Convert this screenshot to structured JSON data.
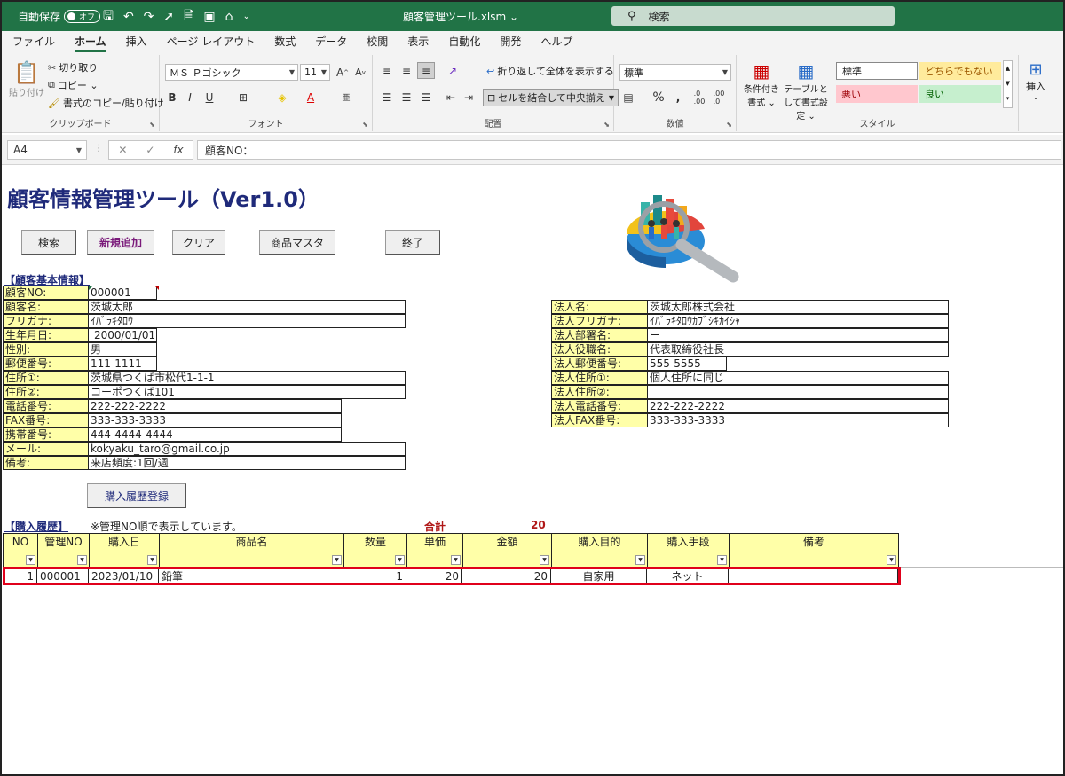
{
  "titlebar": {
    "autosave_label": "自動保存",
    "autosave_state": "オフ",
    "filename": "顧客管理ツール.xlsm ⌄",
    "search_placeholder": "検索"
  },
  "menu": [
    "ファイル",
    "ホーム",
    "挿入",
    "ページ レイアウト",
    "数式",
    "データ",
    "校閲",
    "表示",
    "自動化",
    "開発",
    "ヘルプ"
  ],
  "ribbon": {
    "clipboard": {
      "paste": "貼り付け",
      "cut": "切り取り",
      "copy": "コピー ⌄",
      "format_painter": "書式のコピー/貼り付け",
      "label": "クリップボード"
    },
    "font": {
      "name": "ＭＳ Ｐゴシック",
      "size": "11",
      "label": "フォント"
    },
    "alignment": {
      "wrap": "折り返して全体を表示する",
      "merge": "セルを結合して中央揃え",
      "label": "配置"
    },
    "number": {
      "format": "標準",
      "label": "数値"
    },
    "styles": {
      "cond": "条件付き書式 ⌄",
      "table": "テーブルとして書式設定 ⌄",
      "normal": "標準",
      "neutral": "どちらでもない",
      "bad": "悪い",
      "good": "良い",
      "label": "スタイル"
    },
    "cells": {
      "insert": "挿入"
    }
  },
  "formula_bar": {
    "cell": "A4",
    "content": "顧客NO："
  },
  "sheet": {
    "title": "顧客情報管理ツール（Ver1.0）",
    "buttons": {
      "search": "検索",
      "add": "新規追加",
      "clear": "クリア",
      "master": "商品マスタ",
      "exit": "終了",
      "register": "購入履歴登録"
    },
    "basic_title": "【顧客基本情報】",
    "basic_fields": [
      {
        "label": "顧客NO:",
        "value": "000001"
      },
      {
        "label": "顧客名:",
        "value": "茨城太郎"
      },
      {
        "label": "フリガナ:",
        "value": "ｲﾊﾞﾗｷﾀﾛｳ"
      },
      {
        "label": "生年月日:",
        "value": "2000/01/01"
      },
      {
        "label": "性別:",
        "value": "男"
      },
      {
        "label": "郵便番号:",
        "value": "111-1111"
      },
      {
        "label": "住所①:",
        "value": "茨城県つくば市松代1-1-1"
      },
      {
        "label": "住所②:",
        "value": "コーポつくば101"
      },
      {
        "label": "電話番号:",
        "value": "222-222-2222"
      },
      {
        "label": "FAX番号:",
        "value": "333-333-3333"
      },
      {
        "label": "携帯番号:",
        "value": "444-4444-4444"
      },
      {
        "label": "メール:",
        "value": "kokyaku_taro@gmail.co.jp"
      },
      {
        "label": "備考:",
        "value": "来店頻度:1回/週"
      }
    ],
    "corp_fields": [
      {
        "label": "法人名:",
        "value": "茨城太郎株式会社"
      },
      {
        "label": "法人フリガナ:",
        "value": "ｲﾊﾞﾗｷﾀﾛｳｶﾌﾞｼｷｶｲｼｬ"
      },
      {
        "label": "法人部署名:",
        "value": "ー"
      },
      {
        "label": "法人役職名:",
        "value": "代表取締役社長"
      },
      {
        "label": "法人郵便番号:",
        "value": "555-5555"
      },
      {
        "label": "法人住所①:",
        "value": "個人住所に同じ"
      },
      {
        "label": "法人住所②:",
        "value": ""
      },
      {
        "label": "法人電話番号:",
        "value": "222-222-2222"
      },
      {
        "label": "法人FAX番号:",
        "value": "333-333-3333"
      }
    ],
    "history_title": "【購入履歴】",
    "history_note": "※管理NO順で表示しています。",
    "total_label": "合計",
    "total_value": "20",
    "history_headers": [
      "NO",
      "管理NO",
      "購入日",
      "商品名",
      "数量",
      "単価",
      "金額",
      "購入目的",
      "購入手段",
      "備考"
    ],
    "history_rows": [
      [
        "1",
        "000001",
        "2023/01/10",
        "鉛筆",
        "1",
        "20",
        "20",
        "自家用",
        "ネット",
        ""
      ]
    ]
  }
}
